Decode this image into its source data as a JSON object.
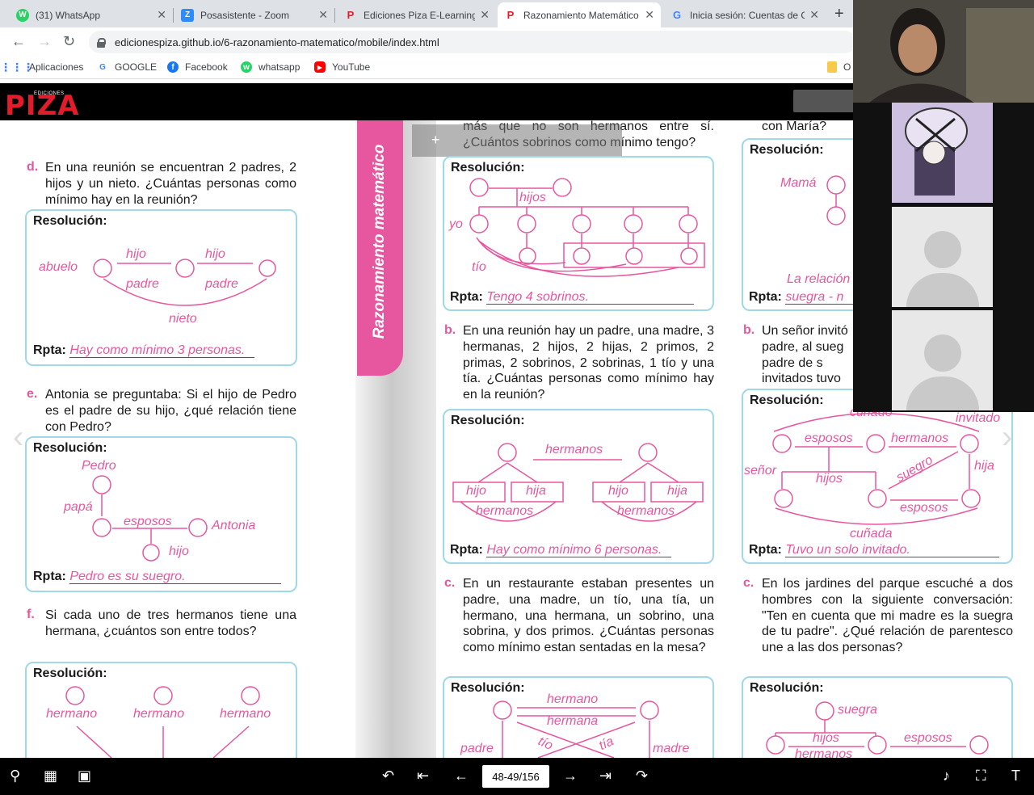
{
  "browser": {
    "tabs": [
      {
        "title": "(31) WhatsApp",
        "icon": "W",
        "color": "#25d366"
      },
      {
        "title": "Posasistente - Zoom",
        "icon": "Z",
        "color": "#2d8cff"
      },
      {
        "title": "Ediciones Piza E-Learning",
        "icon": "P",
        "color": "#e21c2a"
      },
      {
        "title": "Razonamiento Matemático",
        "icon": "P",
        "color": "#e21c2a"
      },
      {
        "title": "Inicia sesión: Cuentas de Google",
        "icon": "G",
        "color": "#4285f4"
      }
    ],
    "url": "edicionespiza.github.io/6-razonamiento-matematico/mobile/index.html",
    "bookmarks": [
      "Aplicaciones",
      "GOOGLE",
      "Facebook",
      "whatsapp",
      "YouTube"
    ],
    "bookmark_folder": "O"
  },
  "viewer": {
    "logo_small": "EDICIONES",
    "logo_big": "PIZA",
    "page_indicator": "48-49/156",
    "side_tab": "Razonamiento matemático"
  },
  "left_page": {
    "d": {
      "label": "d.",
      "text": "En una reunión se encuentran 2 padres, 2 hijos y un nieto. ¿Cuántas personas como mínimo hay en la reunión?",
      "res": "Resolución:",
      "labels": {
        "abuelo": "abuelo",
        "hijo1": "hijo",
        "hijo2": "hijo",
        "padre1": "padre",
        "padre2": "padre",
        "nieto": "nieto"
      },
      "rpta_label": "Rpta:",
      "rpta": "Hay como mínimo 3 personas."
    },
    "e": {
      "label": "e.",
      "text": "Antonia se preguntaba: Si el hijo de Pedro es el padre de su hijo, ¿qué relación tiene con Pedro?",
      "res": "Resolución:",
      "labels": {
        "pedro": "Pedro",
        "papa": "papá",
        "esposos": "esposos",
        "antonia": "Antonia",
        "hijo": "hijo"
      },
      "rpta_label": "Rpta:",
      "rpta": "Pedro es su suegro."
    },
    "f": {
      "label": "f.",
      "text": "Si cada uno de tres hermanos tiene una hermana, ¿cuántos son entre todos?",
      "res": "Resolución:",
      "labels": {
        "h1": "hermano",
        "h2": "hermano",
        "h3": "hermano"
      }
    }
  },
  "middle_col": {
    "top_text": "más que no son hermanos entre sí. ¿Cuántos sobrinos como mínimo tengo?",
    "a": {
      "res": "Resolución:",
      "labels": {
        "hijos": "hijos",
        "yo": "yo",
        "tio": "tío"
      },
      "rpta_label": "Rpta:",
      "rpta": "Tengo 4 sobrinos."
    },
    "b": {
      "label": "b.",
      "text": "En una reunión hay un padre, una madre, 3 hermanas, 2 hijos, 2 hijas, 2 primos, 2 primas, 2 sobrinos, 2 sobrinas, 1 tío y una tía. ¿Cuántas personas como mínimo hay en la reunión?",
      "res": "Resolución:",
      "labels": {
        "hermanos_top": "hermanos",
        "hijo1": "hijo",
        "hija1": "hija",
        "hijo2": "hijo",
        "hija2": "hija",
        "hermanos1": "hermanos",
        "hermanos2": "hermanos"
      },
      "rpta_label": "Rpta:",
      "rpta": "Hay como mínimo 6 personas."
    },
    "c": {
      "label": "c.",
      "text": "En un restaurante estaban presentes un padre, una madre, un tío, una tía, un hermano, una hermana, un sobrino, una sobrina, y dos primos. ¿Cuántas personas como mínimo estan sentadas en la mesa?",
      "res": "Resolución:",
      "labels": {
        "hermano": "hermano",
        "hermana": "hermana",
        "padre": "padre",
        "madre": "madre",
        "tio": "tío",
        "tia": "tía"
      }
    }
  },
  "right_col": {
    "top_text": "con María?",
    "a": {
      "res": "Resolución:",
      "labels": {
        "mama": "Mamá",
        "relacion": "La relación",
        "suegra": "suegra - n"
      },
      "rpta_label": "Rpta:"
    },
    "b": {
      "label": "b.",
      "text_lines": [
        "Un señor invitó",
        "padre, al sueg",
        "padre de s",
        "invitados tuvo"
      ],
      "res": "Resolución:",
      "labels": {
        "cunado_top": "cuñado",
        "invitado": "invitado",
        "esposos1": "esposos",
        "hermanos": "hermanos",
        "senor": "señor",
        "hijos": "hijos",
        "suegro": "suegro",
        "hija": "hija",
        "esposos2": "esposos",
        "cunada": "cuñada"
      },
      "rpta_label": "Rpta:",
      "rpta": "Tuvo un solo invitado."
    },
    "c": {
      "label": "c.",
      "text": "En los jardines del parque escuché a dos hombres con la siguiente conversación: \"Ten en cuenta que mi madre es la suegra de tu padre\". ¿Qué relación de parentesco une a las dos personas?",
      "res": "Resolución:",
      "labels": {
        "suegra": "suegra",
        "hijos": "hijos",
        "esposos": "esposos",
        "hermanos": "hermanos"
      }
    }
  },
  "colors": {
    "accent": "#e6579f",
    "box_border": "#9fd8e6",
    "logo": "#e21c2a"
  }
}
